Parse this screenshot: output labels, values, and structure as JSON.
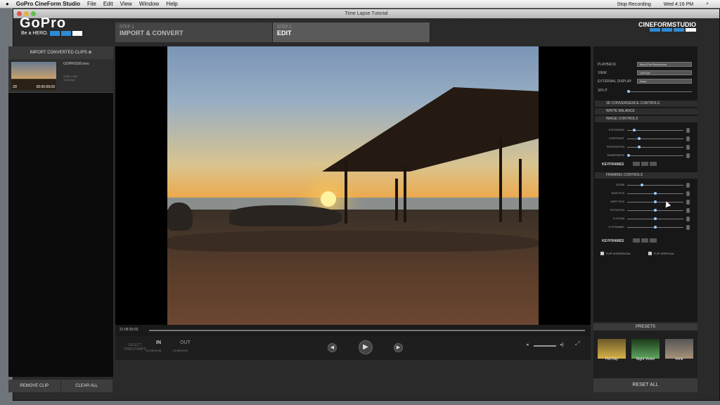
{
  "menubar": {
    "apple": "",
    "app_name": "GoPro CineForm Studio",
    "items": [
      "File",
      "Edit",
      "View",
      "Window",
      "Help"
    ],
    "status": [
      "Stop Recording",
      "Wed 4:16 PM"
    ]
  },
  "window": {
    "title": "Time Lapse Tutorial"
  },
  "branding": {
    "logo": "GoPro",
    "tagline": "Be a HERO.",
    "studio": "CINEFORMSTUDIO"
  },
  "steps": [
    {
      "num": "STEP 1",
      "label": "IMPORT & CONVERT"
    },
    {
      "num": "STEP 2",
      "label": "EDIT"
    }
  ],
  "left_panel": {
    "header": "IMPORT CONVERTED CLIPS",
    "clip": {
      "name": "GOPR0108.mov",
      "mode": "2D",
      "duration": "00:00:09:09",
      "res": "1280 x 960",
      "fps": "15.00 fps"
    },
    "remove": "REMOVE CLIP",
    "clear": "CLEAR ALL"
  },
  "transport": {
    "timecode": "21:08:30:03",
    "select": "SELECT\nTIMESTAMPS",
    "in_label": "IN",
    "in_time": "21:08:30:03",
    "out_label": "OUT",
    "out_time": "21:08:39:09"
  },
  "right_panel": {
    "playback_label": "PLAYBACK",
    "playback_value": "Best (Full Resolution)",
    "view_label": "VIEW",
    "view_value": "Left Eye",
    "external_label": "EXTERNAL DISPLAY",
    "external_value": "None",
    "split_label": "SPLIT",
    "sections": [
      "3D CONVERGENCE CONTROLS",
      "WHITE BALANCE",
      "IMAGE CONTROLS"
    ],
    "image_sliders": [
      {
        "label": "EXPOSURE",
        "value": 0.1
      },
      {
        "label": "CONTRAST",
        "value": 0.2
      },
      {
        "label": "SATURATION",
        "value": 0.2
      },
      {
        "label": "SHARPNESS",
        "value": 0.0
      }
    ],
    "keyframes": "KEYFRAMES",
    "framing_title": "FRAMING CONTROLS",
    "framing_sliders": [
      {
        "label": "ZOOM",
        "value": 0.25
      },
      {
        "label": "HOR POS",
        "value": 0.5
      },
      {
        "label": "VERT POS",
        "value": 0.5
      },
      {
        "label": "ROTATION",
        "value": 0.5
      },
      {
        "label": "H.ZOOM",
        "value": 0.5
      },
      {
        "label": "H.DYNAMIC",
        "value": 0.5
      }
    ],
    "flip_h": "FLIP HORIZONTAL",
    "flip_v": "FLIP VERTICAL"
  },
  "presets": {
    "header": "PRESETS",
    "tiles": [
      "Hot Day",
      "Night Vision",
      "none"
    ],
    "reset": "RESET ALL"
  }
}
